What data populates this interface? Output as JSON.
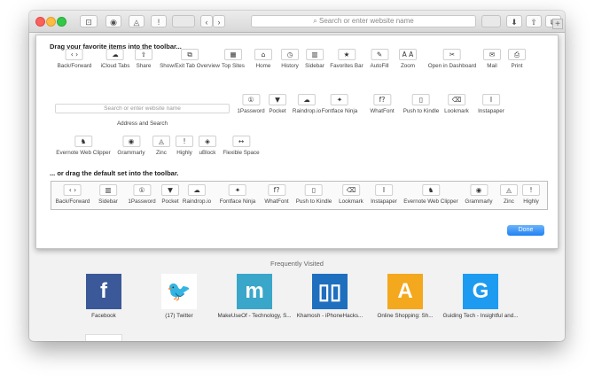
{
  "toolbar": {
    "sidebar_glyph": "⊡",
    "extension1_glyph": "◉",
    "extension2_glyph": "◬",
    "extension3_glyph": "!",
    "back_glyph": "‹",
    "forward_glyph": "›",
    "search_placeholder": "Search or enter website name",
    "download_glyph": "⬇",
    "share_glyph": "⇧",
    "tabs_glyph": "⧉",
    "new_tab_glyph": "+"
  },
  "customize": {
    "heading": "Drag your favorite items into the toolbar...",
    "items_row1": [
      {
        "label": "Back/Forward",
        "glyph": "‹ ›"
      },
      {
        "label": "iCloud Tabs",
        "glyph": "☁"
      },
      {
        "label": "Share",
        "glyph": "⇧"
      },
      {
        "label": "Show/Exit Tab Overview",
        "glyph": "⧉"
      },
      {
        "label": "Top Sites",
        "glyph": "▦"
      },
      {
        "label": "Home",
        "glyph": "⌂"
      },
      {
        "label": "History",
        "glyph": "◷"
      },
      {
        "label": "Sidebar",
        "glyph": "▥"
      },
      {
        "label": "Favorites Bar",
        "glyph": "★"
      },
      {
        "label": "AutoFill",
        "glyph": "✎"
      },
      {
        "label": "Zoom",
        "glyph": "A A"
      },
      {
        "label": "Open in Dashboard",
        "glyph": "✂"
      },
      {
        "label": "Mail",
        "glyph": "✉"
      },
      {
        "label": "Print",
        "glyph": "⎙"
      }
    ],
    "address_placeholder": "Search or enter website name",
    "address_label": "Address and Search",
    "items_row2": [
      {
        "label": "1Password",
        "glyph": "①"
      },
      {
        "label": "Pocket",
        "glyph": "▼"
      },
      {
        "label": "Raindrop.io",
        "glyph": "☁"
      },
      {
        "label": "Fontface Ninja",
        "glyph": "✦"
      },
      {
        "label": "WhatFont",
        "glyph": "f?"
      },
      {
        "label": "Push to Kindle",
        "glyph": "▯"
      },
      {
        "label": "Lookmark",
        "glyph": "⌫"
      },
      {
        "label": "Instapaper",
        "glyph": "I"
      }
    ],
    "items_row3": [
      {
        "label": "Evernote Web Clipper",
        "glyph": "♞"
      },
      {
        "label": "Grammarly",
        "glyph": "◉"
      },
      {
        "label": "Zinc",
        "glyph": "◬"
      },
      {
        "label": "Highly",
        "glyph": "!"
      },
      {
        "label": "uBlock",
        "glyph": "◈"
      },
      {
        "label": "Flexible Space",
        "glyph": "↔"
      }
    ],
    "default_heading": "... or drag the default set into the toolbar.",
    "default_set": [
      {
        "label": "Back/Forward",
        "glyph": "‹ ›"
      },
      {
        "label": "Sidebar",
        "glyph": "▥"
      },
      {
        "label": "1Password",
        "glyph": "①"
      },
      {
        "label": "Pocket",
        "glyph": "▼"
      },
      {
        "label": "Raindrop.io",
        "glyph": "☁"
      },
      {
        "label": "Fontface Ninja",
        "glyph": "✦"
      },
      {
        "label": "WhatFont",
        "glyph": "f?"
      },
      {
        "label": "Push to Kindle",
        "glyph": "▯"
      },
      {
        "label": "Lookmark",
        "glyph": "⌫"
      },
      {
        "label": "Instapaper",
        "glyph": "I"
      },
      {
        "label": "Evernote Web Clipper",
        "glyph": "♞"
      },
      {
        "label": "Grammarly",
        "glyph": "◉"
      },
      {
        "label": "Zinc",
        "glyph": "◬"
      },
      {
        "label": "Highly",
        "glyph": "!"
      }
    ],
    "done_label": "Done"
  },
  "frequently_visited": {
    "title": "Frequently Visited",
    "sites": [
      {
        "name": "Facebook",
        "letter": "f",
        "color": "#3b5998"
      },
      {
        "name": "(17) Twitter",
        "letter": "🐦",
        "color": "#ffffff"
      },
      {
        "name": "MakeUseOf - Technology, S...",
        "letter": "m",
        "color": "#3aa6c9"
      },
      {
        "name": "Khamosh - iPhoneHacks...",
        "letter": "▯▯",
        "color": "#1f6fbf"
      },
      {
        "name": "Online Shopping: Sh...",
        "letter": "A",
        "color": "#f4a81d"
      },
      {
        "name": "Guiding Tech - Insightful and...",
        "letter": "G",
        "color": "#1d9bf0"
      }
    ]
  }
}
